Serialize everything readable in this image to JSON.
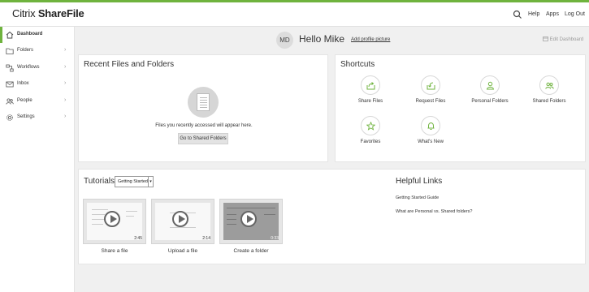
{
  "brand": {
    "name_light": "Citrix ",
    "name_bold": "ShareFile",
    "accent": "#6fb33e"
  },
  "topnav": {
    "search_icon": "search-icon",
    "help": "Help",
    "apps": "Apps",
    "logout": "Log Out"
  },
  "sidebar": {
    "items": [
      {
        "label": "Dashboard",
        "icon": "home-icon",
        "active": true
      },
      {
        "label": "Folders",
        "icon": "folder-icon"
      },
      {
        "label": "Workflows",
        "icon": "workflow-icon"
      },
      {
        "label": "Inbox",
        "icon": "inbox-icon"
      },
      {
        "label": "People",
        "icon": "people-icon"
      },
      {
        "label": "Settings",
        "icon": "gear-icon"
      }
    ]
  },
  "header": {
    "initials": "MD",
    "greeting": "Hello Mike",
    "add_picture": "Add profile picture",
    "edit_dashboard": "Edit Dashboard"
  },
  "recent": {
    "title": "Recent Files and Folders",
    "empty_message": "Files you recently accessed will appear here.",
    "button": "Go to Shared Folders"
  },
  "shortcuts": {
    "title": "Shortcuts",
    "items": [
      {
        "label": "Share Files",
        "icon": "share-icon"
      },
      {
        "label": "Request Files",
        "icon": "request-icon"
      },
      {
        "label": "Personal Folders",
        "icon": "person-icon"
      },
      {
        "label": "Shared Folders",
        "icon": "group-icon"
      },
      {
        "label": "Favorites",
        "icon": "star-icon"
      },
      {
        "label": "What's New",
        "icon": "bell-icon"
      }
    ]
  },
  "tutorials": {
    "title": "Tutorials",
    "select_value": "Getting Started",
    "videos": [
      {
        "label": "Share a file",
        "duration": "2:45"
      },
      {
        "label": "Upload a file",
        "duration": "2:14"
      },
      {
        "label": "Create a folder",
        "duration": "0:33"
      }
    ]
  },
  "helpful": {
    "title": "Helpful Links",
    "links": [
      "Getting Started Guide",
      "What are Personal vs. Shared folders?"
    ]
  }
}
